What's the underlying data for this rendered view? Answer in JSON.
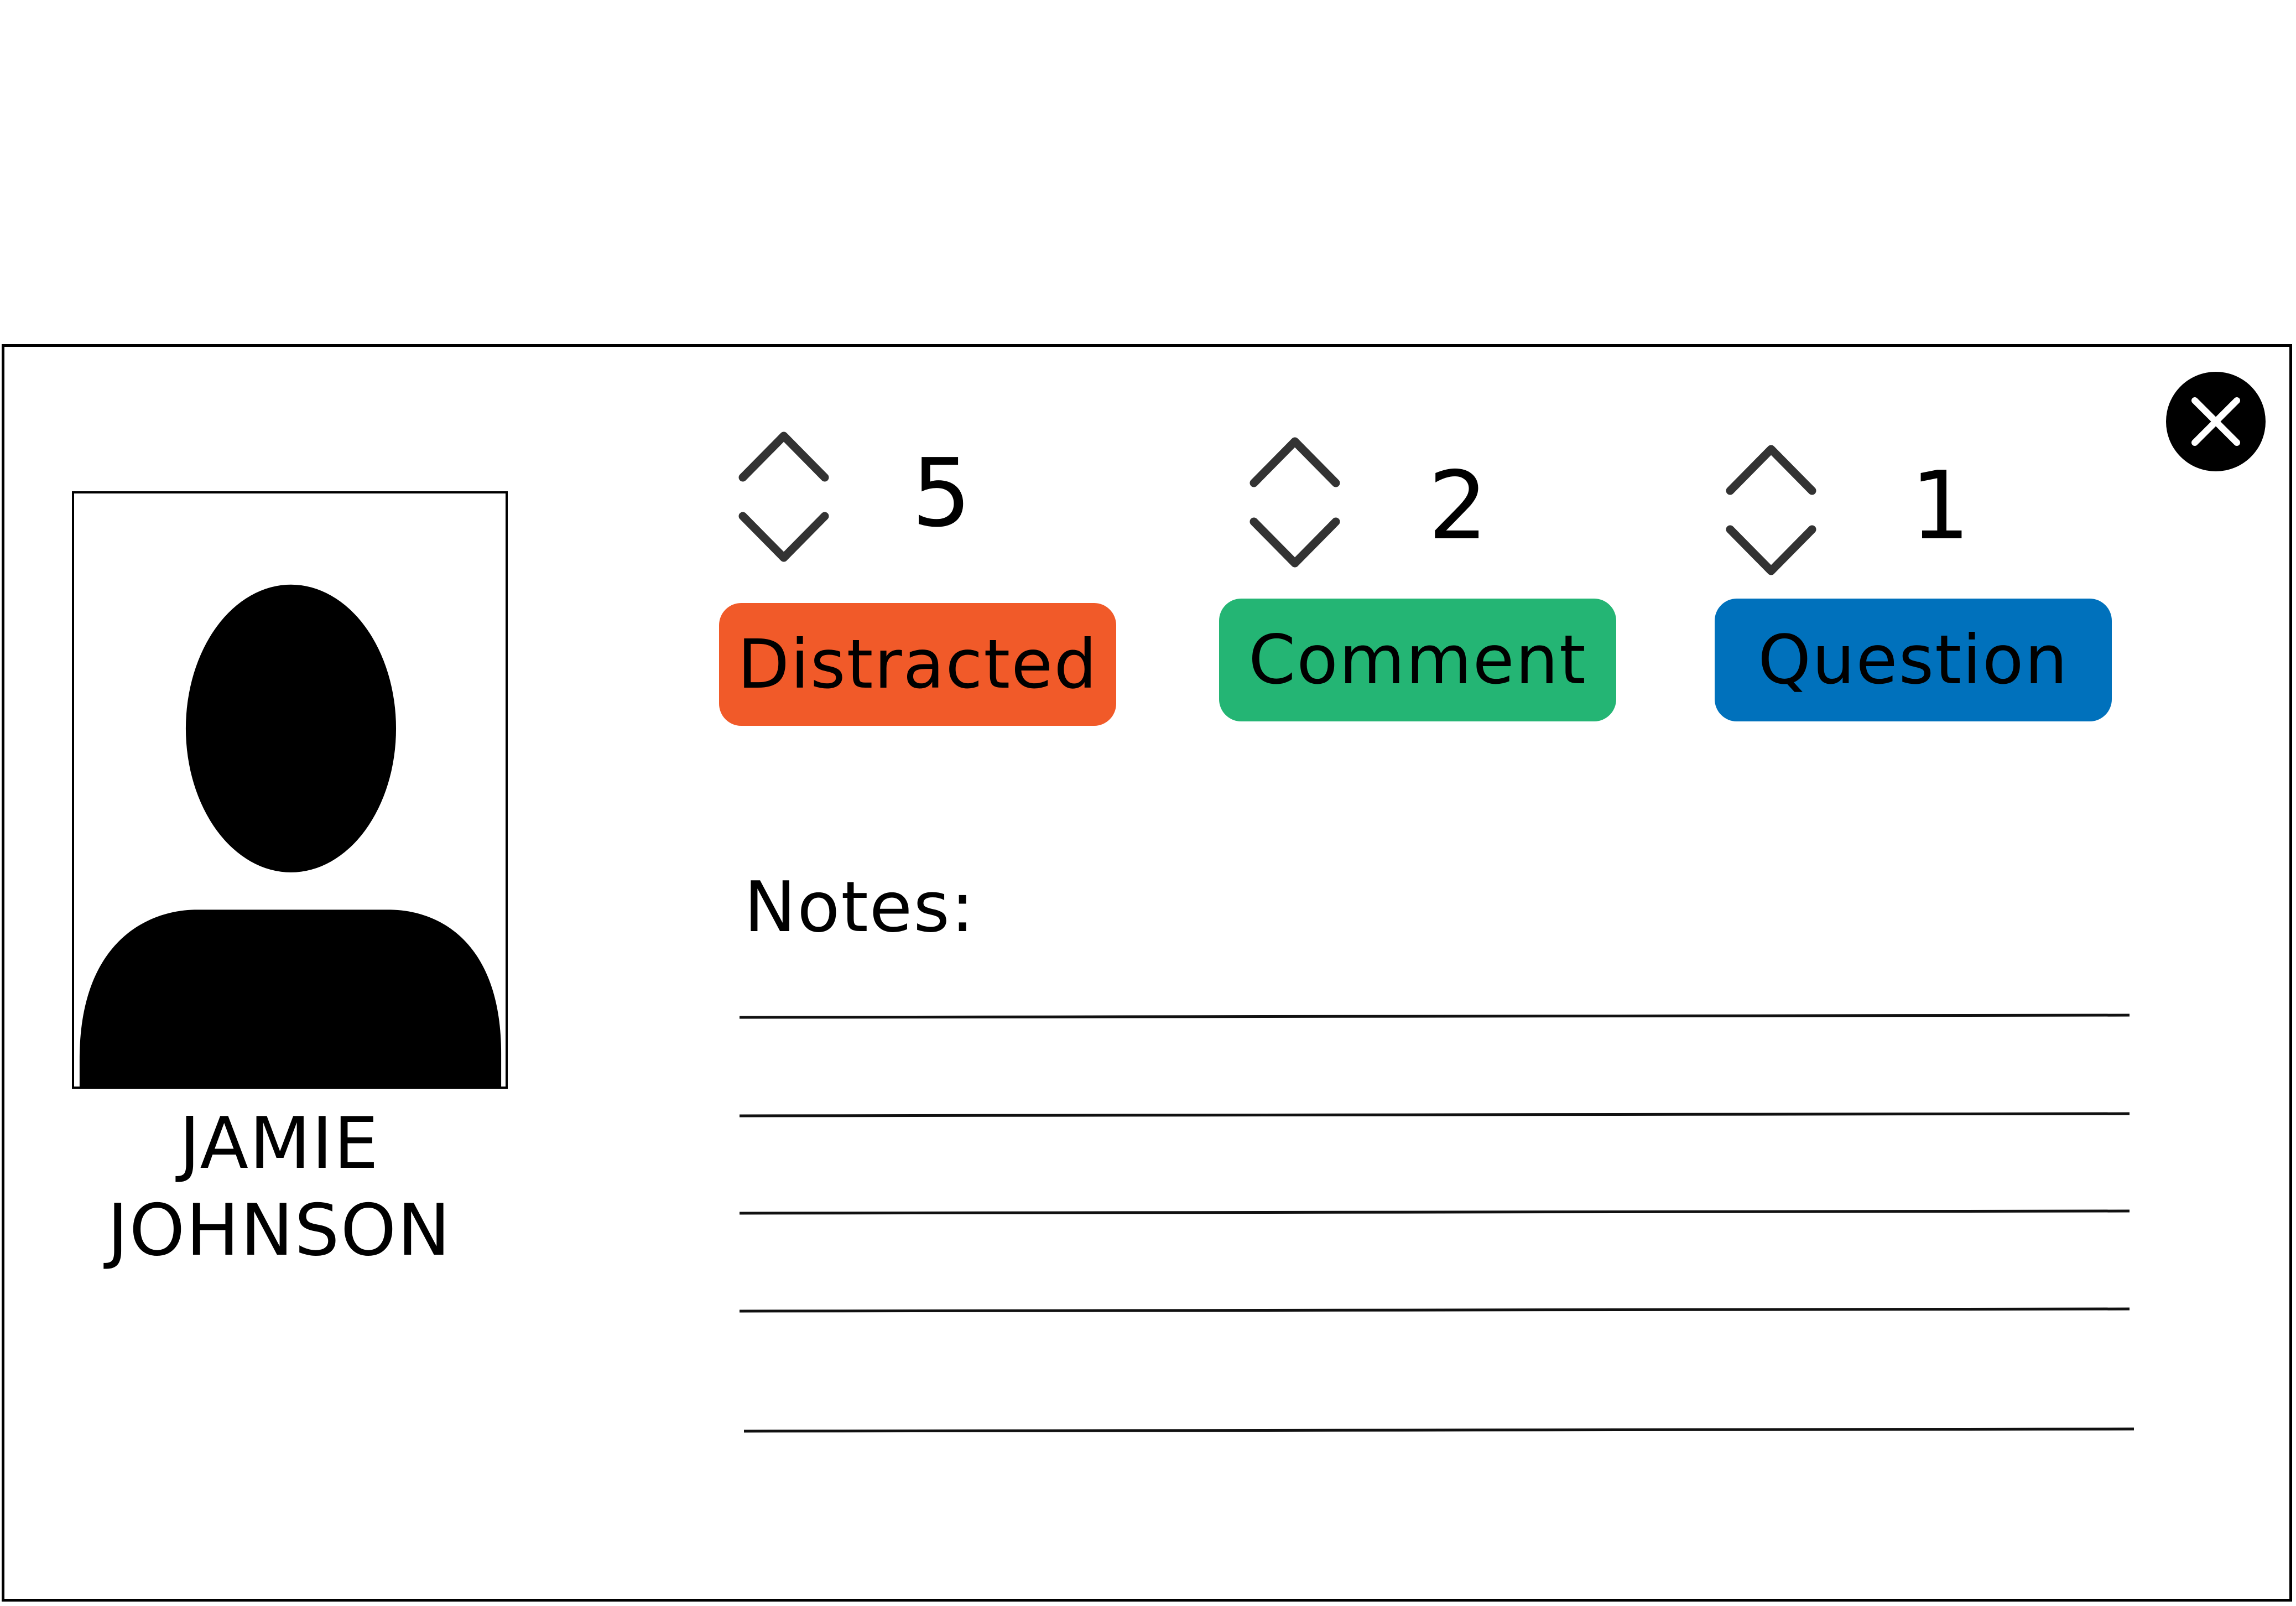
{
  "student": {
    "first_name": "JAMIE",
    "last_name": "JOHNSON",
    "avatar_icon": "person-silhouette-icon"
  },
  "counters": [
    {
      "label": "Distracted",
      "count": "5",
      "color": "#F15A29",
      "up_icon": "chevron-up-icon",
      "down_icon": "chevron-down-icon"
    },
    {
      "label": "Comment",
      "count": "2",
      "color": "#24B574",
      "up_icon": "chevron-up-icon",
      "down_icon": "chevron-down-icon"
    },
    {
      "label": "Question",
      "count": "1",
      "color": "#0071BC",
      "up_icon": "chevron-up-icon",
      "down_icon": "chevron-down-icon"
    }
  ],
  "notes": {
    "label": "Notes:",
    "lines": [
      "",
      "",
      "",
      "",
      ""
    ]
  },
  "close": {
    "icon": "close-icon"
  }
}
